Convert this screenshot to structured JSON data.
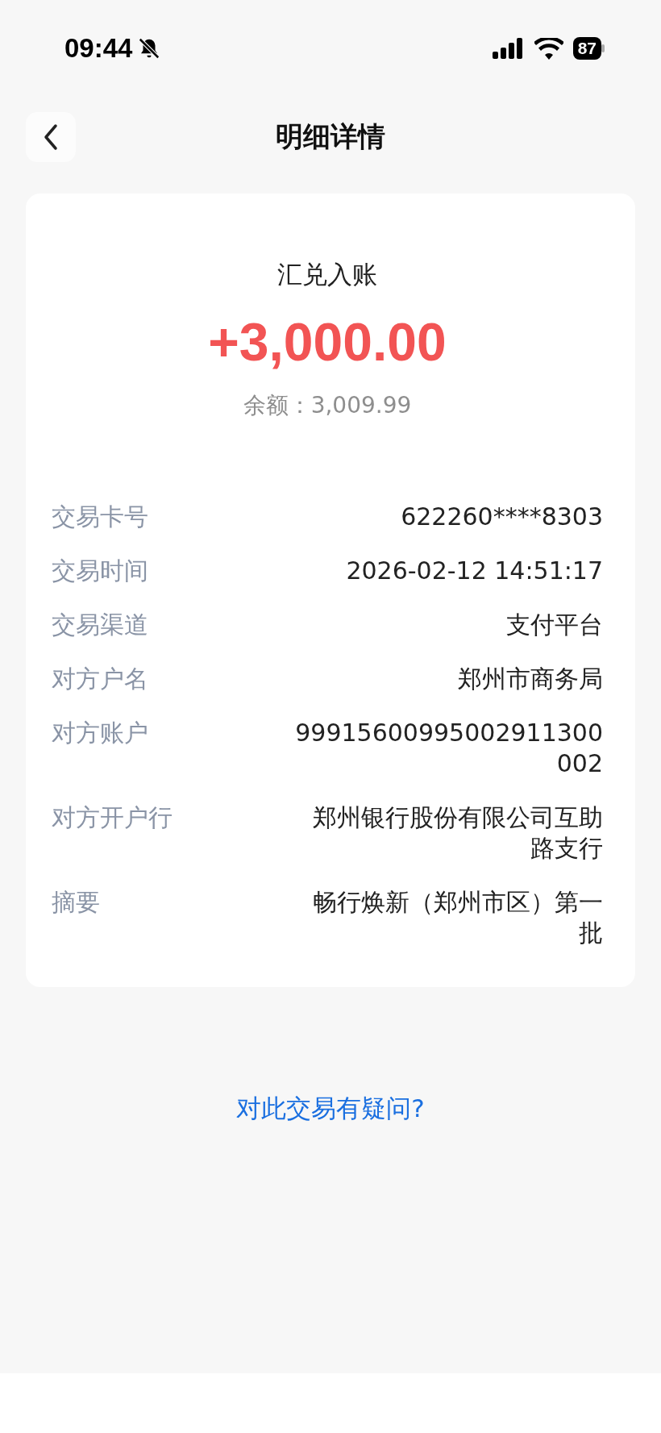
{
  "status_bar": {
    "time": "09:44",
    "battery": "87"
  },
  "nav": {
    "title": "明细详情"
  },
  "summary": {
    "type": "汇兑入账",
    "amount": "+3,000.00",
    "balance": "余额：3,009.99"
  },
  "details": [
    {
      "label": "交易卡号",
      "value": "622260****8303"
    },
    {
      "label": "交易时间",
      "value": "2026-02-12 14:51:17"
    },
    {
      "label": "交易渠道",
      "value": "支付平台"
    },
    {
      "label": "对方户名",
      "value": "郑州市商务局"
    },
    {
      "label": "对方账户",
      "value": "99915600995002911300002"
    },
    {
      "label": "对方开户行",
      "value": "郑州银行股份有限公司互助路支行"
    },
    {
      "label": "摘要",
      "value": "畅行焕新（郑州市区）第一批"
    }
  ],
  "link": "对此交易有疑问?"
}
